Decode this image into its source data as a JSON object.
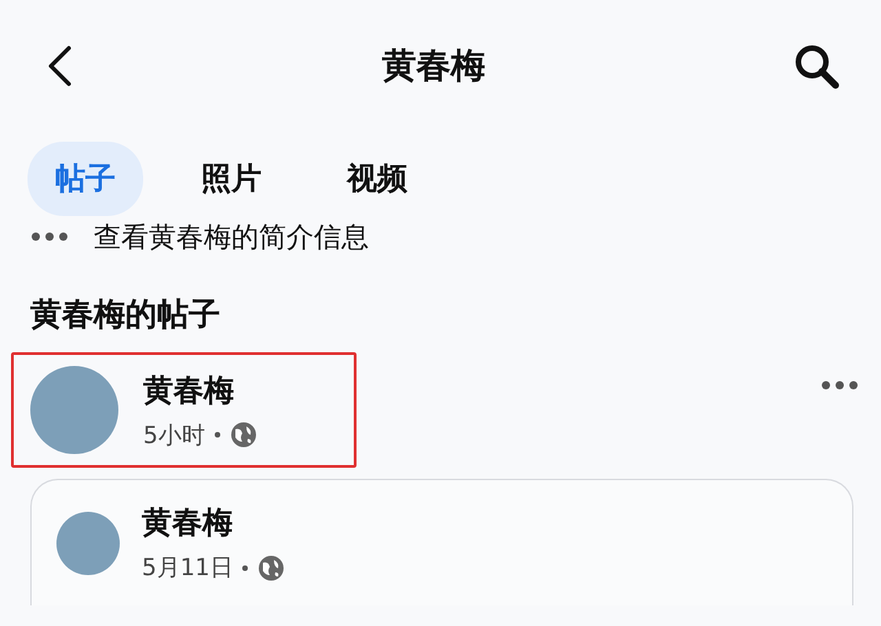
{
  "header": {
    "title": "黄春梅"
  },
  "tabs": [
    {
      "label": "帖子",
      "selected": true
    },
    {
      "label": "照片",
      "selected": false
    },
    {
      "label": "视频",
      "selected": false
    }
  ],
  "about_link": {
    "text": "查看黄春梅的简介信息"
  },
  "section_title": "黄春梅的帖子",
  "posts": [
    {
      "author": "黄春梅",
      "time": "5小时",
      "highlighted": true,
      "kind": "plain"
    },
    {
      "author": "黄春梅",
      "time": "5月11日",
      "kind": "card"
    }
  ]
}
